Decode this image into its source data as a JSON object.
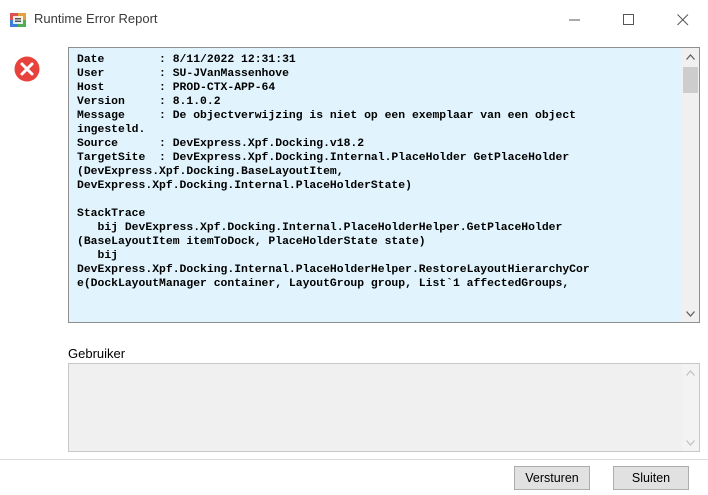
{
  "window": {
    "title": "Runtime Error Report",
    "app_icon": "app-window-icon",
    "controls": [
      "minimize-icon",
      "maximize-icon",
      "close-icon"
    ]
  },
  "error_icon": "error-icon",
  "details": {
    "background": "#e1f4fd",
    "text": "Date        : 8/11/2022 12:31:31\nUser        : SU-JVanMassenhove\nHost        : PROD-CTX-APP-64\nVersion     : 8.1.0.2\nMessage     : De objectverwijzing is niet op een exemplaar van een object\ningesteld.\nSource      : DevExpress.Xpf.Docking.v18.2\nTargetSite  : DevExpress.Xpf.Docking.Internal.PlaceHolder GetPlaceHolder\n(DevExpress.Xpf.Docking.BaseLayoutItem,\nDevExpress.Xpf.Docking.Internal.PlaceHolderState)\n\nStackTrace\n   bij DevExpress.Xpf.Docking.Internal.PlaceHolderHelper.GetPlaceHolder\n(BaseLayoutItem itemToDock, PlaceHolderState state)\n   bij\nDevExpress.Xpf.Docking.Internal.PlaceHolderHelper.RestoreLayoutHierarchyCor\ne(DockLayoutManager container, LayoutGroup group, List`1 affectedGroups,"
  },
  "user": {
    "label": "Gebruiker",
    "value": ""
  },
  "buttons": {
    "send": "Versturen",
    "close": "Sluiten"
  }
}
